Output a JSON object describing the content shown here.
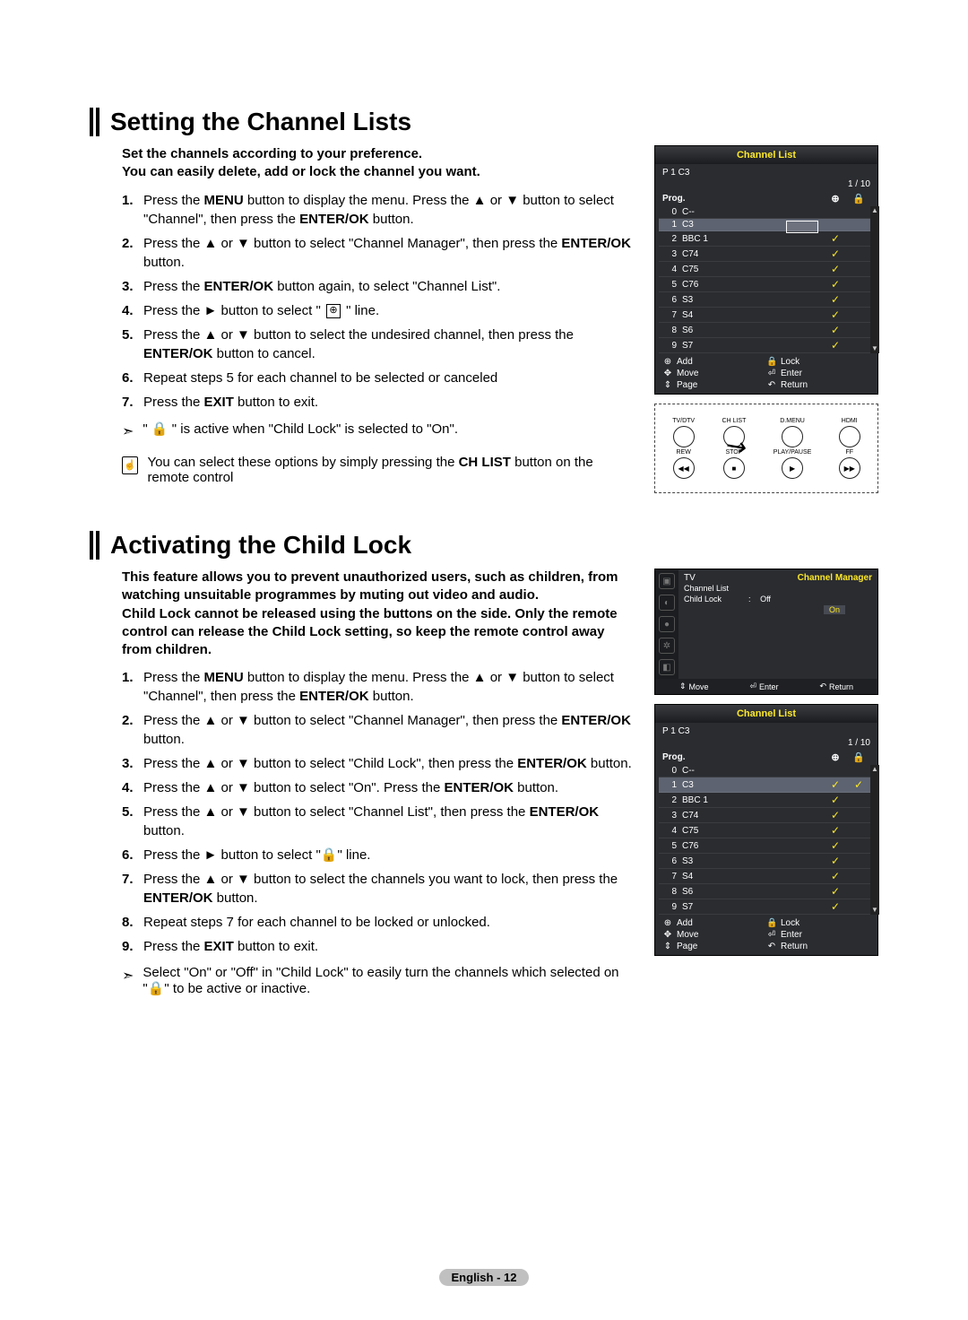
{
  "section1": {
    "title": "Setting the Channel Lists",
    "intro": "Set the channels according to your preference.\nYou can easily delete, add or lock the channel you want.",
    "steps": [
      {
        "n": "1.",
        "html": "Press the <b>MENU</b> button to display the menu. Press the ▲ or ▼ button to select \"Channel\", then press the <b>ENTER/OK</b> button."
      },
      {
        "n": "2.",
        "html": "Press the ▲ or ▼ button to select \"Channel Manager\", then press the <b>ENTER/OK</b> button."
      },
      {
        "n": "3.",
        "html": "Press the <b>ENTER/OK</b> button again, to select \"Channel List\"."
      },
      {
        "n": "4.",
        "html": "Press the ► button to select \" <span class='inline-ico'>⊕</span> \" line."
      },
      {
        "n": "5.",
        "html": "Press the ▲ or ▼ button to select the undesired channel, then press the <b>ENTER/OK</b> button to cancel."
      },
      {
        "n": "6.",
        "html": "Repeat steps 5 for each channel to be selected or canceled"
      },
      {
        "n": "7.",
        "html": "Press the <b>EXIT</b> button to exit."
      }
    ],
    "arrow_note": "\" 🔒 \" is active when \"Child Lock\" is selected to \"On\".",
    "box_note": "You can select these options by simply pressing the <b>CH LIST</b> button on the remote control"
  },
  "osd1": {
    "title": "Channel List",
    "current": "P  1  C3",
    "page": "1 / 10",
    "header": {
      "prog": "Prog.",
      "add": "⊕",
      "lock": "🔒"
    },
    "rows": [
      {
        "n": "0",
        "ch": "C--",
        "add": "",
        "lock": "",
        "hl": false
      },
      {
        "n": "1",
        "ch": "C3",
        "add": "",
        "lock": "",
        "hl": true
      },
      {
        "n": "2",
        "ch": "BBC 1",
        "add": "✓",
        "lock": "",
        "hl": false
      },
      {
        "n": "3",
        "ch": "C74",
        "add": "✓",
        "lock": "",
        "hl": false
      },
      {
        "n": "4",
        "ch": "C75",
        "add": "✓",
        "lock": "",
        "hl": false
      },
      {
        "n": "5",
        "ch": "C76",
        "add": "✓",
        "lock": "",
        "hl": false
      },
      {
        "n": "6",
        "ch": "S3",
        "add": "✓",
        "lock": "",
        "hl": false
      },
      {
        "n": "7",
        "ch": "S4",
        "add": "✓",
        "lock": "",
        "hl": false
      },
      {
        "n": "8",
        "ch": "S6",
        "add": "✓",
        "lock": "",
        "hl": false
      },
      {
        "n": "9",
        "ch": "S7",
        "add": "✓",
        "lock": "",
        "hl": false
      }
    ],
    "footer": {
      "add": "Add",
      "lock": "Lock",
      "move": "Move",
      "enter": "Enter",
      "page": "Page",
      "return": "Return"
    }
  },
  "remote": {
    "labels": [
      "TV/DTV",
      "CH LIST",
      "D.MENU",
      "HDMI",
      "REW",
      "STOP",
      "PLAY/PAUSE",
      "FF"
    ]
  },
  "section2": {
    "title": "Activating the Child Lock",
    "intro": "This feature allows you to prevent unauthorized users, such as children, from watching unsuitable programmes by muting out video and audio.\nChild Lock cannot be released using the buttons on the side. Only the remote control can release the Child Lock setting, so keep the remote control away from children.",
    "steps": [
      {
        "n": "1.",
        "html": "Press the <b>MENU</b> button to display the menu. Press the ▲ or ▼ button to select \"Channel\", then press the <b>ENTER/OK</b> button."
      },
      {
        "n": "2.",
        "html": "Press the ▲ or ▼ button to select \"Channel Manager\", then press the <b>ENTER/OK</b> button."
      },
      {
        "n": "3.",
        "html": "Press the ▲ or ▼ button to select \"Child Lock\", then press the <b>ENTER/OK</b> button."
      },
      {
        "n": "4.",
        "html": "Press the ▲ or ▼ button to select \"On\". Press the <b>ENTER/OK</b> button."
      },
      {
        "n": "5.",
        "html": "Press the ▲ or ▼ button to select \"Channel List\", then press the <b>ENTER/OK</b> button."
      },
      {
        "n": "6.",
        "html": "Press the ► button to select \"🔒\" line."
      },
      {
        "n": "7.",
        "html": "Press the ▲ or ▼ button to select the channels you want to lock, then press the <b>ENTER/OK</b> button."
      },
      {
        "n": "8.",
        "html": "Repeat steps 7 for each channel to be locked or unlocked."
      },
      {
        "n": "9.",
        "html": "Press the <b>EXIT</b> button to exit."
      }
    ],
    "arrow_note": "Select \"On\" or \"Off\" in \"Child Lock\" to easily turn the channels which selected on \"🔒\" to be active or inactive."
  },
  "cm": {
    "tv": "TV",
    "title": "Channel Manager",
    "line1": "Channel List",
    "line2": "Child Lock",
    "off": "Off",
    "on": "On",
    "foot": {
      "move": "Move",
      "enter": "Enter",
      "return": "Return"
    }
  },
  "osd2": {
    "title": "Channel List",
    "current": "P  1  C3",
    "page": "1 / 10",
    "header": {
      "prog": "Prog.",
      "add": "⊕",
      "lock": "🔒"
    },
    "rows": [
      {
        "n": "0",
        "ch": "C--",
        "add": "",
        "lock": "",
        "hl": false
      },
      {
        "n": "1",
        "ch": "C3",
        "add": "✓",
        "lock": "✓",
        "hl": true
      },
      {
        "n": "2",
        "ch": "BBC 1",
        "add": "✓",
        "lock": "",
        "hl": false
      },
      {
        "n": "3",
        "ch": "C74",
        "add": "✓",
        "lock": "",
        "hl": false
      },
      {
        "n": "4",
        "ch": "C75",
        "add": "✓",
        "lock": "",
        "hl": false
      },
      {
        "n": "5",
        "ch": "C76",
        "add": "✓",
        "lock": "",
        "hl": false
      },
      {
        "n": "6",
        "ch": "S3",
        "add": "✓",
        "lock": "",
        "hl": false
      },
      {
        "n": "7",
        "ch": "S4",
        "add": "✓",
        "lock": "",
        "hl": false
      },
      {
        "n": "8",
        "ch": "S6",
        "add": "✓",
        "lock": "",
        "hl": false
      },
      {
        "n": "9",
        "ch": "S7",
        "add": "✓",
        "lock": "",
        "hl": false
      }
    ],
    "footer": {
      "add": "Add",
      "lock": "Lock",
      "move": "Move",
      "enter": "Enter",
      "page": "Page",
      "return": "Return"
    }
  },
  "footer": "English - 12"
}
